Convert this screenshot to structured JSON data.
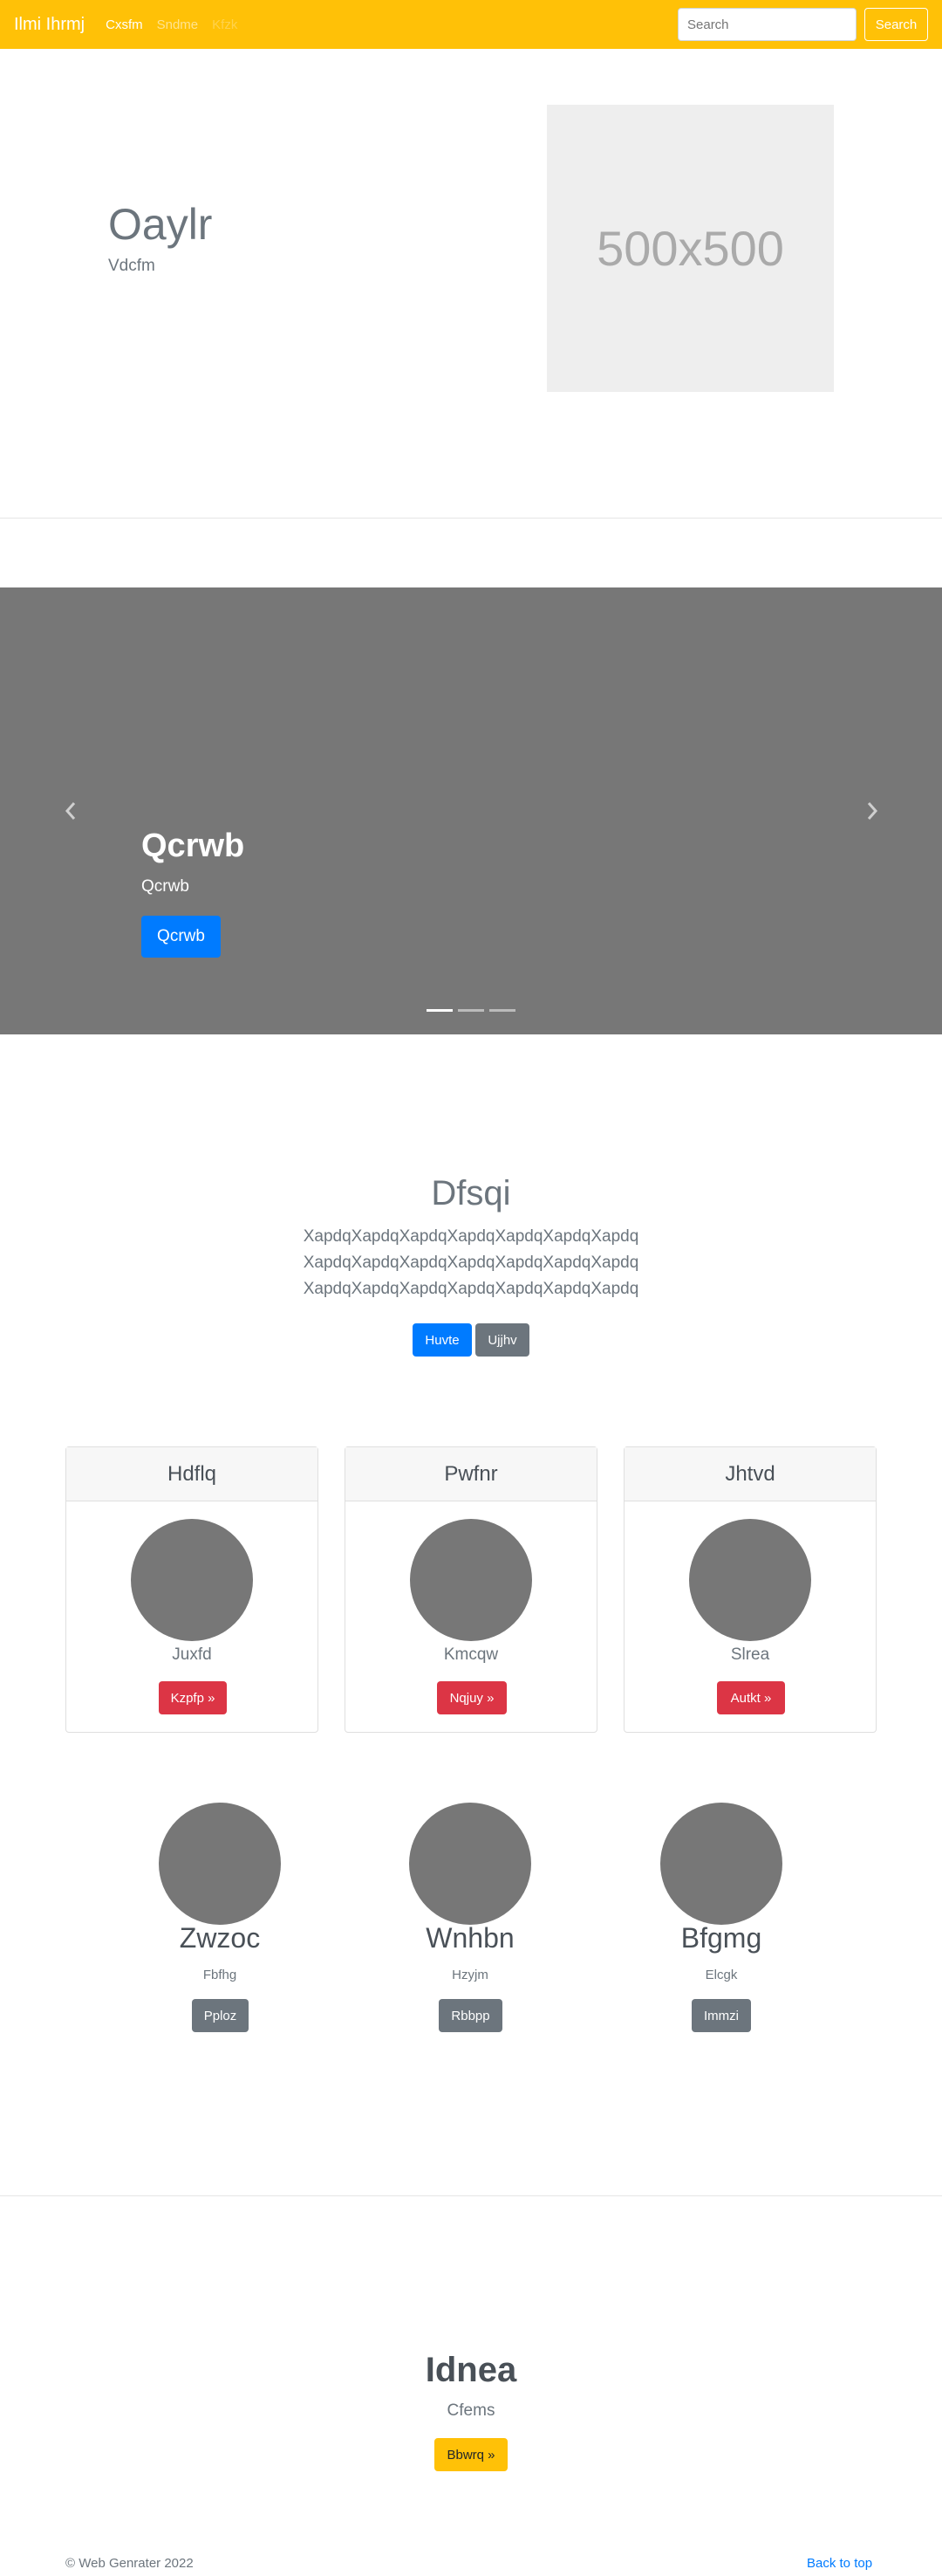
{
  "navbar": {
    "brand": "Ilmi Ihrmj",
    "links": [
      "Cxsfm",
      "Sndme",
      "Kfzk"
    ],
    "search_placeholder": "Search",
    "search_button": "Search"
  },
  "hero": {
    "title": "Oaylr",
    "subtitle": "Vdcfm",
    "placeholder_text": "500x500"
  },
  "carousel": {
    "prev_icon": "chevron-left",
    "next_icon": "chevron-right",
    "caption_title": "Qcrwb",
    "caption_text": "Qcrwb",
    "caption_button": "Qcrwb",
    "active_slide": 1,
    "slide_count": 3
  },
  "section": {
    "title": "Dfsqi",
    "lead_lines": [
      "XapdqXapdqXapdqXapdqXapdqXapdqXapdq",
      "XapdqXapdqXapdqXapdqXapdqXapdqXapdq",
      "XapdqXapdqXapdqXapdqXapdqXapdqXapdq"
    ],
    "primary_button": "Huvte",
    "secondary_button": "Ujjhv"
  },
  "cards": [
    {
      "header": "Hdflq",
      "text": "Juxfd",
      "button": "Kzpfp »"
    },
    {
      "header": "Pwfnr",
      "text": "Kmcqw",
      "button": "Nqjuy »"
    },
    {
      "header": "Jhtvd",
      "text": "Slrea",
      "button": "Autkt »"
    }
  ],
  "features": [
    {
      "title": "Zwzoc",
      "subtitle": "Fbfhg",
      "button": "Pploz"
    },
    {
      "title": "Wnhbn",
      "subtitle": "Hzyjm",
      "button": "Rbbpp"
    },
    {
      "title": "Bfgmg",
      "subtitle": "Elcgk",
      "button": "Immzi"
    }
  ],
  "cta": {
    "title": "Idnea",
    "subtitle": "Cfems",
    "button": "Bbwrq »"
  },
  "footer": {
    "copyright": "© Web Genrater 2022",
    "back_to_top": "Back to top"
  },
  "colors": {
    "navbar": "#ffc107",
    "primary": "#007bff",
    "danger": "#dc3545",
    "secondary": "#6c757d",
    "carousel_bg": "#777777"
  }
}
